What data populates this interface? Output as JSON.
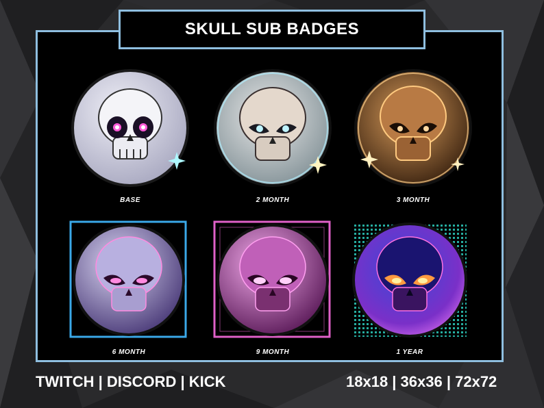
{
  "title": "SKULL SUB BADGES",
  "badges": [
    {
      "label": "BASE",
      "theme": "white",
      "orb_color": "#c8c8d8",
      "glow": "#e0eaff"
    },
    {
      "label": "2 MONTH",
      "theme": "cyan glow",
      "orb_color": "#d8cfc4",
      "glow": "#7fe6ff"
    },
    {
      "label": "3 MONTH",
      "theme": "orange glow",
      "orb_color": "#b8773a",
      "glow": "#ffb050"
    },
    {
      "label": "6 MONTH",
      "theme": "lavender pink",
      "orb_color": "#9a8fc8",
      "glow": "#ff6ad8"
    },
    {
      "label": "9 MONTH",
      "theme": "magenta",
      "orb_color": "#b04aa8",
      "glow": "#ff5ae0"
    },
    {
      "label": "1 YEAR",
      "theme": "neon blue purple",
      "orb_color": "#4a2ea8",
      "glow": "#ff8a3a"
    }
  ],
  "footer": {
    "platforms": "TWITCH | DISCORD | KICK",
    "sizes": "18x18  | 36x36 | 72x72"
  },
  "colors": {
    "frame_border": "#8fbfe0",
    "panel_bg": "#000000",
    "text": "#ffffff"
  }
}
